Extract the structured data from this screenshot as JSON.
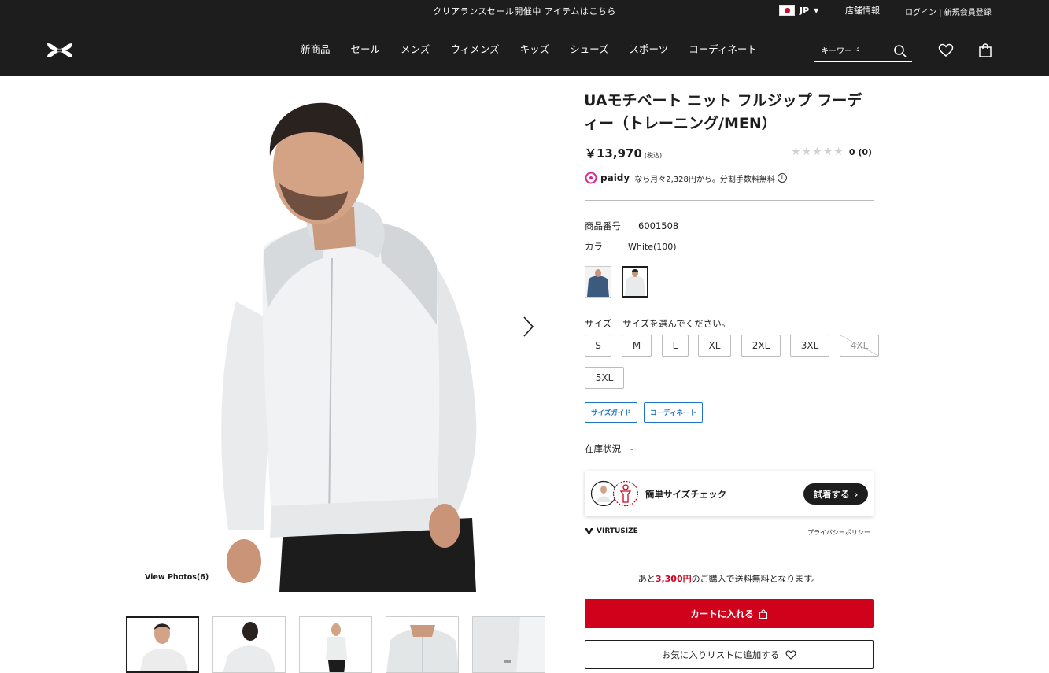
{
  "topbar": {
    "promo": "クリアランスセール開催中 アイテムはこちら",
    "locale": "JP",
    "store_info": "店舗情報",
    "login": "ログイン | 新規会員登録"
  },
  "header": {
    "nav": [
      "新商品",
      "セール",
      "メンズ",
      "ウィメンズ",
      "キッズ",
      "シューズ",
      "スポーツ",
      "コーディネート"
    ],
    "search_placeholder": "キーワード"
  },
  "gallery": {
    "view_photos": "View Photos(6)"
  },
  "product": {
    "title": "UAモチベート ニット フルジップ フーディー（トレーニング/MEN）",
    "price": "￥13,970",
    "tax": "(税込)",
    "rating_count": "0",
    "rating_paren": "(0)",
    "rating_stars": 0,
    "paidy_brand": "paidy",
    "paidy_text": "なら月々2,328円から。分割手数料無料",
    "item_no_label": "商品番号",
    "item_no": "6001508",
    "color_label": "カラー",
    "color_value": "White(100)",
    "size_label": "サイズ",
    "size_hint": "サイズを選んでください。",
    "sizes": [
      "S",
      "M",
      "L",
      "XL",
      "2XL",
      "3XL",
      "4XL",
      "5XL"
    ],
    "size_guide": "サイズガイド",
    "coordinate": "コーディネート",
    "stock_label": "在庫状況",
    "stock_value": "-"
  },
  "virtusize": {
    "check_text": "簡単サイズチェック",
    "try_label": "試着する",
    "brand": "VIRTUSIZE",
    "privacy": "プライバシーポリシー"
  },
  "shipping": {
    "prefix": "あと",
    "amount": "3,300円",
    "suffix": "のご購入で送料無料となります。"
  },
  "actions": {
    "add_to_cart": "カートに入れる",
    "add_to_favorites": "お気に入りリストに追加する"
  },
  "colors": {
    "brand_red": "#d0021b",
    "header_bg": "#1d1d1d",
    "link_blue": "#1e74c7"
  }
}
